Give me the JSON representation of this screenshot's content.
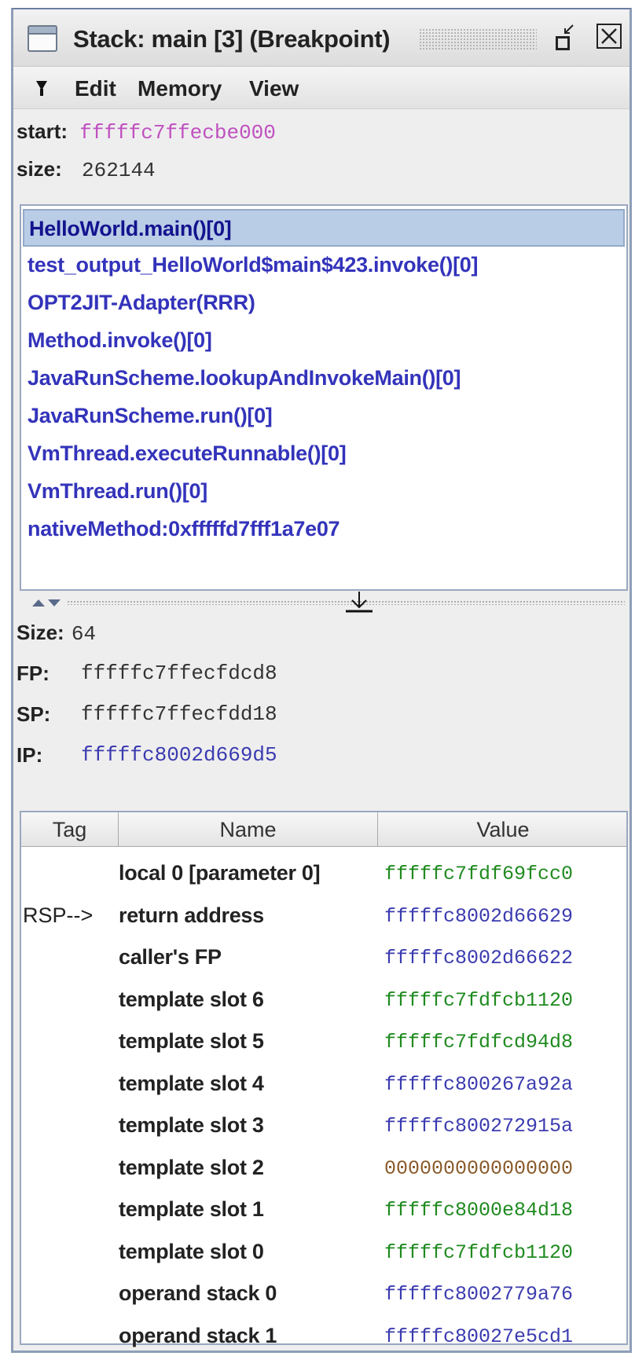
{
  "window": {
    "title": "Stack: main [3] (Breakpoint)"
  },
  "menu": {
    "items": [
      "Edit",
      "Memory",
      "View"
    ]
  },
  "stack_info": {
    "start_label": "start:",
    "start_value": "fffffc7ffecbe000",
    "size_label": "size:",
    "size_value": "262144"
  },
  "frames": [
    "HelloWorld.main()[0]",
    "test_output_HelloWorld$main$423.invoke()[0]",
    "OPT2JIT-Adapter(RRR)",
    "Method.invoke()[0]",
    "JavaRunScheme.lookupAndInvokeMain()[0]",
    "JavaRunScheme.run()[0]",
    "VmThread.executeRunnable()[0]",
    "VmThread.run()[0]",
    "nativeMethod:0xfffffd7fff1a7e07"
  ],
  "selected_frame_index": 0,
  "frame_info": {
    "size_label": "Size:",
    "size_value": "64",
    "fp_label": "FP:",
    "fp_value": "fffffc7ffecfdcd8",
    "sp_label": "SP:",
    "sp_value": "fffffc7ffecfdd18",
    "ip_label": "IP:",
    "ip_value": "fffffc8002d669d5"
  },
  "table": {
    "columns": [
      "Tag",
      "Name",
      "Value"
    ],
    "rows": [
      {
        "tag": "",
        "name": "local 0 [parameter 0]",
        "value": "fffffc7fdf69fcc0",
        "color": "#1f8a1f"
      },
      {
        "tag": "RSP-->",
        "name": "return address",
        "value": "fffffc8002d66629",
        "color": "#3b3bb0"
      },
      {
        "tag": "",
        "name": "caller's FP",
        "value": "fffffc8002d66622",
        "color": "#3b3bb0"
      },
      {
        "tag": "",
        "name": "template slot 6",
        "value": "fffffc7fdfcb1120",
        "color": "#1f8a1f"
      },
      {
        "tag": "",
        "name": "template slot 5",
        "value": "fffffc7fdfcd94d8",
        "color": "#1f8a1f"
      },
      {
        "tag": "",
        "name": "template slot 4",
        "value": "fffffc800267a92a",
        "color": "#3b3bb0"
      },
      {
        "tag": "",
        "name": "template slot 3",
        "value": "fffffc800272915a",
        "color": "#3b3bb0"
      },
      {
        "tag": "",
        "name": "template slot 2",
        "value": "0000000000000000",
        "color": "#8a5a2a"
      },
      {
        "tag": "",
        "name": "template slot 1",
        "value": "fffffc8000e84d18",
        "color": "#1f8a1f"
      },
      {
        "tag": "",
        "name": "template slot 0",
        "value": "fffffc7fdfcb1120",
        "color": "#1f8a1f"
      },
      {
        "tag": "",
        "name": "operand stack 0",
        "value": "fffffc8002779a76",
        "color": "#3b3bb0"
      },
      {
        "tag": "",
        "name": "operand stack 1",
        "value": "fffffc80027e5cd1",
        "color": "#3b3bb0"
      }
    ]
  },
  "colors": {
    "start_value": "#c050c0",
    "size_value": "#333333",
    "fp_value": "#333333",
    "sp_value": "#333333",
    "ip_value": "#3b3bb0",
    "frame_text": "#3333bb",
    "selection": "#b9cde6"
  },
  "icons": [
    "window-icon",
    "restore-icon",
    "close-icon",
    "menu-arrow-icon",
    "splitter-arrows-icon",
    "splitter-handle-icon"
  ]
}
